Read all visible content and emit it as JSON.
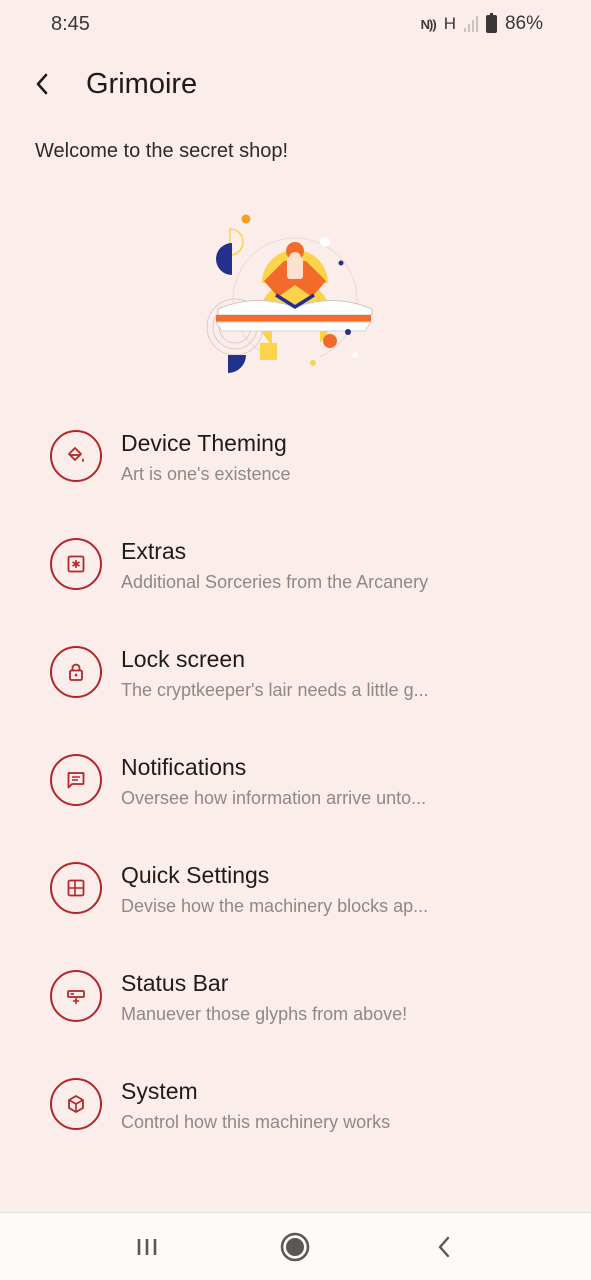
{
  "status_bar": {
    "time": "8:45",
    "nfc": "N",
    "network_type": "H",
    "battery": "86%"
  },
  "app_bar": {
    "title": "Grimoire",
    "back_icon": "chevron-left-icon"
  },
  "welcome_text": "Welcome to the secret shop!",
  "colors": {
    "background": "#fbeeea",
    "accent": "#b3262b",
    "title_text": "#1f1b1a",
    "subtitle_text": "#8e8886",
    "illustration_orange": "#f26b2a",
    "illustration_yellow": "#fcd44b",
    "illustration_navy": "#23308c"
  },
  "items": [
    {
      "title": "Device Theming",
      "subtitle": "Art is one's existence",
      "icon": "paint-bucket-icon"
    },
    {
      "title": "Extras",
      "subtitle": "Additional Sorceries from the Arcanery",
      "icon": "asterisk-box-icon"
    },
    {
      "title": "Lock screen",
      "subtitle": "The cryptkeeper's lair needs a little g...",
      "icon": "lock-icon"
    },
    {
      "title": "Notifications",
      "subtitle": "Oversee how information arrive unto...",
      "icon": "message-icon"
    },
    {
      "title": "Quick Settings",
      "subtitle": "Devise how the machinery blocks ap...",
      "icon": "tiles-icon"
    },
    {
      "title": "Status Bar",
      "subtitle": "Manuever those glyphs from above!",
      "icon": "status-bar-icon"
    },
    {
      "title": "System",
      "subtitle": "Control how this machinery works",
      "icon": "cube-icon"
    }
  ],
  "nav_bar": {
    "recents_icon": "recents-icon",
    "home_icon": "home-icon",
    "back_icon": "back-icon"
  }
}
